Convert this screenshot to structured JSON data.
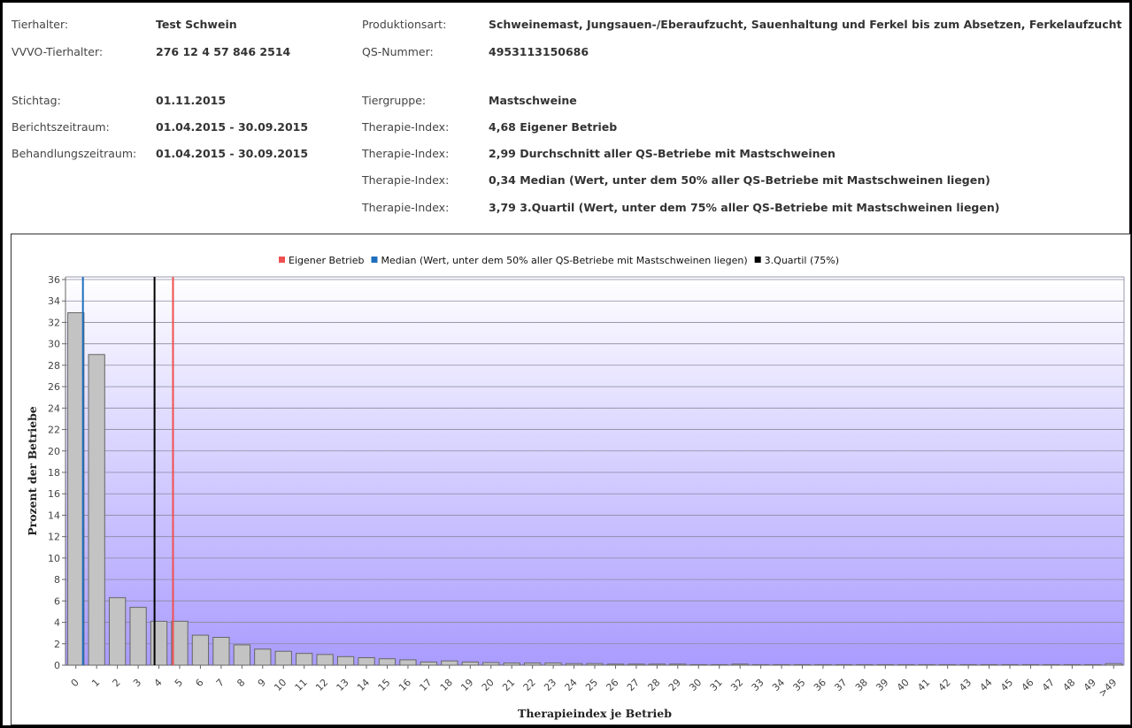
{
  "info": {
    "left": [
      {
        "label": "Tierhalter:",
        "value": "Test Schwein"
      },
      {
        "label": "VVVO-Tierhalter:",
        "value": "276 12 4 57 846 2514"
      },
      {
        "label": "Stichtag:",
        "value": "01.11.2015"
      },
      {
        "label": "Berichtszeitraum:",
        "value": "01.04.2015 - 30.09.2015"
      },
      {
        "label": "Behandlungszeitraum:",
        "value": "01.04.2015 - 30.09.2015"
      }
    ],
    "right": [
      {
        "label": "Produktionsart:",
        "value": "Schweinemast, Jungsauen-/Eberaufzucht, Sauenhaltung und Ferkel bis zum Absetzen, Ferkelaufzucht"
      },
      {
        "label": "QS-Nummer:",
        "value": "4953113150686"
      },
      {
        "label": "Tiergruppe:",
        "value": "Mastschweine"
      },
      {
        "label": "Therapie-Index:",
        "value": "4,68  Eigener Betrieb"
      },
      {
        "label": "Therapie-Index:",
        "value": "2,99  Durchschnitt aller QS-Betriebe mit Mastschweinen"
      },
      {
        "label": "Therapie-Index:",
        "value": "0,34  Median (Wert, unter dem 50% aller QS-Betriebe mit Mastschweinen liegen)"
      },
      {
        "label": "Therapie-Index:",
        "value": "3,79  3.Quartil (Wert, unter dem 75% aller QS-Betriebe mit Mastschweinen liegen)"
      }
    ]
  },
  "chart_data": {
    "type": "bar",
    "xlabel": "Therapieindex je Betrieb",
    "ylabel": "Prozent der Betriebe",
    "ylim": [
      0,
      36
    ],
    "yticks": [
      0,
      2,
      4,
      6,
      8,
      10,
      12,
      14,
      16,
      18,
      20,
      22,
      24,
      26,
      28,
      30,
      32,
      34,
      36
    ],
    "grid": true,
    "legend_position": "top-center",
    "categories": [
      "0",
      "1",
      "2",
      "3",
      "4",
      "5",
      "6",
      "7",
      "8",
      "9",
      "10",
      "11",
      "12",
      "13",
      "14",
      "15",
      "16",
      "17",
      "18",
      "19",
      "20",
      "21",
      "22",
      "23",
      "24",
      "25",
      "26",
      "27",
      "28",
      "29",
      "30",
      "31",
      "32",
      "33",
      "34",
      "35",
      "36",
      "37",
      "38",
      "39",
      "40",
      "41",
      "42",
      "43",
      "44",
      "45",
      "46",
      "47",
      "48",
      "49",
      ">49"
    ],
    "values": [
      32.9,
      29.0,
      6.3,
      5.4,
      4.1,
      4.1,
      2.8,
      2.6,
      1.9,
      1.5,
      1.3,
      1.1,
      1.0,
      0.8,
      0.7,
      0.6,
      0.5,
      0.3,
      0.4,
      0.3,
      0.25,
      0.2,
      0.2,
      0.2,
      0.15,
      0.15,
      0.1,
      0.1,
      0.1,
      0.1,
      0.05,
      0.05,
      0.1,
      0.05,
      0.05,
      0.05,
      0.05,
      0.05,
      0.05,
      0.05,
      0.05,
      0.05,
      0.05,
      0.05,
      0.05,
      0.05,
      0.05,
      0.05,
      0.05,
      0.05,
      0.15
    ],
    "bar_color": "#c3c3c3",
    "markers": [
      {
        "name": "Eigener Betrieb",
        "x": 4.68,
        "color": "#f05050"
      },
      {
        "name": "Median (Wert, unter dem 50% aller QS-Betriebe mit Mastschweinen liegen)",
        "x": 0.34,
        "color": "#1f6fbf"
      },
      {
        "name": "3.Quartil (75%)",
        "x": 3.79,
        "color": "#000000"
      }
    ]
  }
}
